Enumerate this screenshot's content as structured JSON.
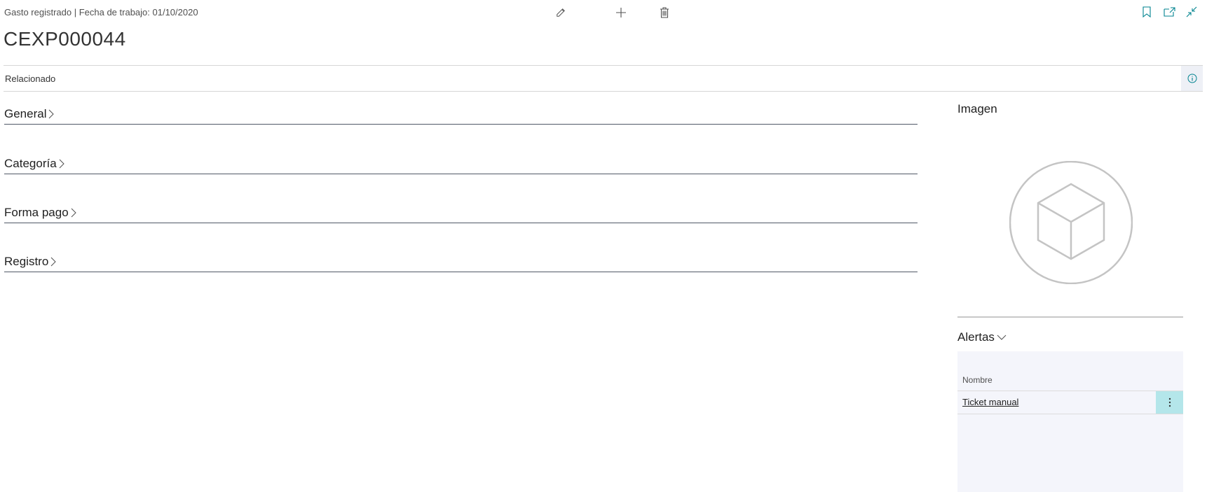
{
  "header": {
    "caption": "Gasto registrado | Fecha de trabajo: 01/10/2020",
    "record_title": "CEXP000044",
    "actions": [
      "pencil-icon",
      "plus-icon",
      "trash-icon"
    ],
    "right_actions": [
      "bookmark-icon",
      "open-new-window-icon",
      "collapse-icon"
    ]
  },
  "related": {
    "label": "Relacionado"
  },
  "sections": [
    {
      "title": "General"
    },
    {
      "title": "Categoría"
    },
    {
      "title": "Forma pago"
    },
    {
      "title": "Registro"
    }
  ],
  "factbox": {
    "image_title": "Imagen",
    "alerts_title": "Alertas",
    "alerts_column": "Nombre",
    "alerts_rows": [
      {
        "name": "Ticket manual"
      }
    ]
  },
  "colors": {
    "accent": "#00838f",
    "row_highlight": "#b4e6ea",
    "factbox_bg": "#f4f5fb"
  }
}
